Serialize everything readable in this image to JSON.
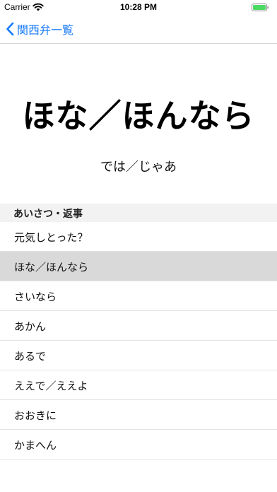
{
  "status_bar": {
    "carrier": "Carrier",
    "time": "10:28 PM",
    "wifi_icon": "wifi-icon",
    "battery_icon": "battery-full-icon",
    "battery_color": "#4cd964"
  },
  "nav": {
    "back_label": "関西弁一覧",
    "back_icon": "chevron-left-icon",
    "accent_color": "#1479fa"
  },
  "phrase": {
    "word": "ほな／ほんなら",
    "meaning": "では／じゃあ"
  },
  "section": {
    "title": "あいさつ・返事"
  },
  "list": {
    "items": [
      {
        "label": "元気しとった？",
        "selected": false
      },
      {
        "label": "ほな／ほんなら",
        "selected": true
      },
      {
        "label": "さいなら",
        "selected": false
      },
      {
        "label": "あかん",
        "selected": false
      },
      {
        "label": "あるで",
        "selected": false
      },
      {
        "label": "ええで／ええよ",
        "selected": false
      },
      {
        "label": "おおきに",
        "selected": false
      },
      {
        "label": "かまへん",
        "selected": false
      }
    ]
  }
}
